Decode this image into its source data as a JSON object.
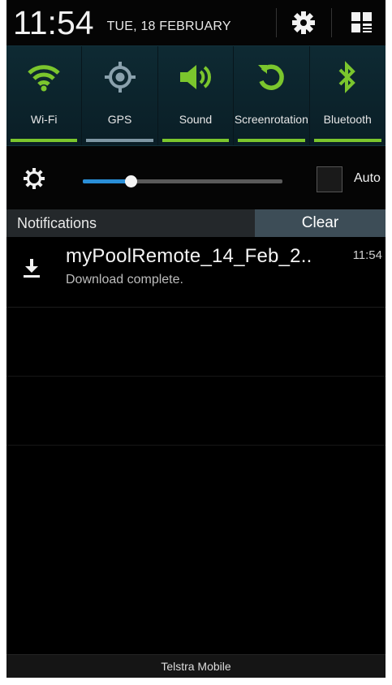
{
  "status": {
    "time": "11:54",
    "date": "TUE, 18 FEBRUARY"
  },
  "header_icons": {
    "settings": "gear-icon",
    "grid": "grid-edit-icon"
  },
  "quick_toggles": [
    {
      "label": "Wi-Fi",
      "icon": "wifi-icon",
      "state": "on"
    },
    {
      "label": "GPS",
      "icon": "gps-icon",
      "state": "off"
    },
    {
      "label": "Sound",
      "icon": "sound-icon",
      "state": "on"
    },
    {
      "label": "Screen rotation",
      "label_line1": "Screen",
      "label_line2": "rotation",
      "icon": "rotation-icon",
      "state": "on"
    },
    {
      "label": "Bluetooth",
      "icon": "bluetooth-icon",
      "state": "on"
    }
  ],
  "brightness": {
    "icon": "brightness-icon",
    "level": 0.24,
    "auto_label": "Auto",
    "auto_checked": false
  },
  "notifications": {
    "title": "Notifications",
    "clear_label": "Clear",
    "items": [
      {
        "icon": "download-icon",
        "name": "myPoolRemote_14_Feb_2..",
        "time": "11:54",
        "message": "Download complete."
      }
    ]
  },
  "carrier": "Telstra Mobile",
  "colors": {
    "accent_on": "#7bc62d",
    "accent_off": "#7e96a3",
    "slider": "#2a8fd7",
    "clear_bg": "#3d4d57"
  }
}
